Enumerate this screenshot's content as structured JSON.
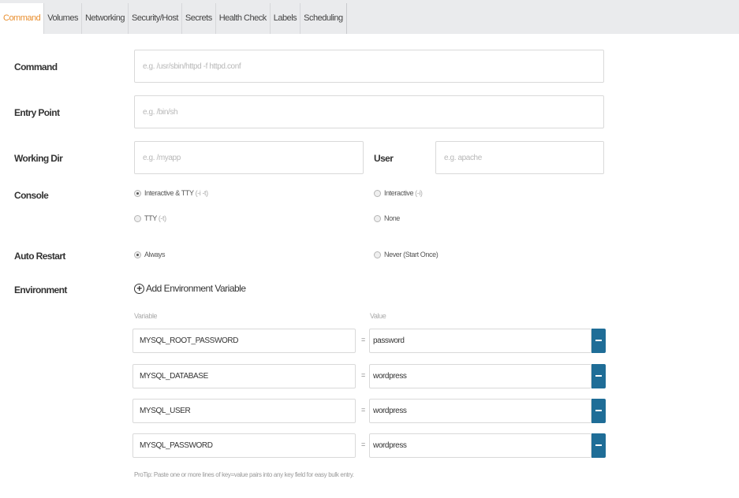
{
  "tabs": [
    {
      "label": "Command",
      "active": true
    },
    {
      "label": "Volumes",
      "active": false
    },
    {
      "label": "Networking",
      "active": false
    },
    {
      "label": "Security/Host",
      "active": false
    },
    {
      "label": "Secrets",
      "active": false
    },
    {
      "label": "Health Check",
      "active": false
    },
    {
      "label": "Labels",
      "active": false
    },
    {
      "label": "Scheduling",
      "active": false
    }
  ],
  "command": {
    "label": "Command",
    "placeholder": "e.g. /usr/sbin/httpd -f httpd.conf",
    "value": ""
  },
  "entry_point": {
    "label": "Entry Point",
    "placeholder": "e.g. /bin/sh",
    "value": ""
  },
  "working_dir": {
    "label": "Working Dir",
    "placeholder": "e.g. /myapp",
    "value": ""
  },
  "user": {
    "label": "User",
    "placeholder": "e.g. apache",
    "value": ""
  },
  "console": {
    "label": "Console",
    "options": [
      {
        "label": "Interactive & TTY",
        "hint": "(-i -t)",
        "selected": true
      },
      {
        "label": "Interactive",
        "hint": "(-i)",
        "selected": false
      },
      {
        "label": "TTY",
        "hint": "(-t)",
        "selected": false
      },
      {
        "label": "None",
        "hint": "",
        "selected": false
      }
    ]
  },
  "auto_restart": {
    "label": "Auto Restart",
    "options": [
      {
        "label": "Always",
        "selected": true
      },
      {
        "label": "Never (Start Once)",
        "selected": false
      }
    ]
  },
  "environment": {
    "label": "Environment",
    "add_label": "Add Environment Variable",
    "variable_header": "Variable",
    "value_header": "Value",
    "equals": "=",
    "rows": [
      {
        "key": "MYSQL_ROOT_PASSWORD",
        "value": "password"
      },
      {
        "key": "MYSQL_DATABASE",
        "value": "wordpress"
      },
      {
        "key": "MYSQL_USER",
        "value": "wordpress"
      },
      {
        "key": "MYSQL_PASSWORD",
        "value": "wordpress"
      }
    ],
    "protip": "ProTip: Paste one or more lines of key=value pairs into any key field for easy bulk entry."
  },
  "colors": {
    "active_tab_text": "#e98f2f",
    "tab_bar_bg": "#eaebed",
    "remove_button": "#1f6d97"
  }
}
